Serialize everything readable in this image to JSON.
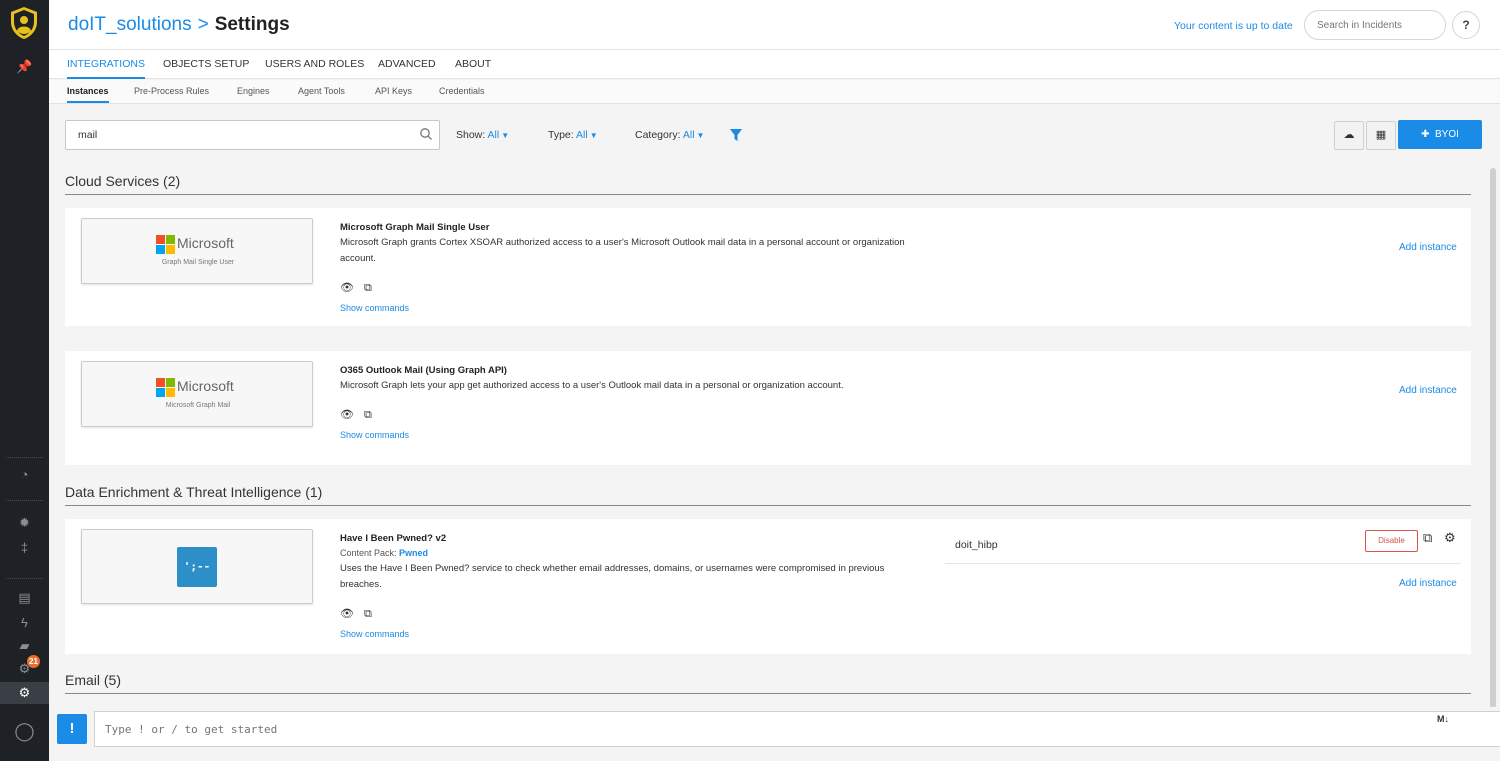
{
  "header": {
    "org": "doIT_solutions",
    "separator": ">",
    "title": "Settings",
    "status": "Your content is up to date",
    "search_placeholder": "Search in Incidents",
    "help_label": "?"
  },
  "tabs": [
    "INTEGRATIONS",
    "OBJECTS SETUP",
    "USERS AND ROLES",
    "ADVANCED",
    "ABOUT"
  ],
  "subtabs": [
    "Instances",
    "Pre-Process Rules",
    "Engines",
    "Agent Tools",
    "API Keys",
    "Credentials"
  ],
  "filters": {
    "search_value": "mail",
    "show_label": "Show:",
    "show_value": "All",
    "type_label": "Type:",
    "type_value": "All",
    "category_label": "Category:",
    "category_value": "All",
    "byoi_label": "BYOI"
  },
  "sections": [
    {
      "title": "Cloud Services (2)"
    },
    {
      "title": "Data Enrichment & Threat Intelligence (1)"
    },
    {
      "title": "Email (5)"
    }
  ],
  "cards": [
    {
      "logo_text": "Microsoft",
      "logo_sub": "Graph Mail Single User",
      "title": "Microsoft Graph Mail Single User",
      "desc": "Microsoft Graph grants Cortex XSOAR authorized access to a user's Microsoft Outlook mail data in a personal account or organization account.",
      "show_commands": "Show commands",
      "add_instance": "Add instance"
    },
    {
      "logo_text": "Microsoft",
      "logo_sub": "Microsoft Graph Mail",
      "title": "O365 Outlook Mail (Using Graph API)",
      "desc": "Microsoft Graph lets your app get authorized access to a user's Outlook mail data in a personal or organization account.",
      "show_commands": "Show commands",
      "add_instance": "Add instance"
    },
    {
      "logo_text": "';--",
      "title": "Have I Been Pwned? v2",
      "pack_label": "Content Pack:",
      "pack_name": "Pwned",
      "desc": "Uses the Have I Been Pwned? service to check whether email addresses, domains, or usernames were compromised in previous breaches.",
      "show_commands": "Show commands",
      "instance_name": "doit_hibp",
      "disable_label": "Disable",
      "add_instance": "Add instance"
    }
  ],
  "sidebar": {
    "badge_count": "21"
  },
  "command_bar": {
    "button_label": "!",
    "placeholder": "Type ! or / to get started",
    "md_label": "M↓"
  },
  "colors": {
    "accent": "#1a8be6",
    "sidebar": "#1e2126",
    "danger": "#d9534f",
    "badge": "#e8702a"
  }
}
